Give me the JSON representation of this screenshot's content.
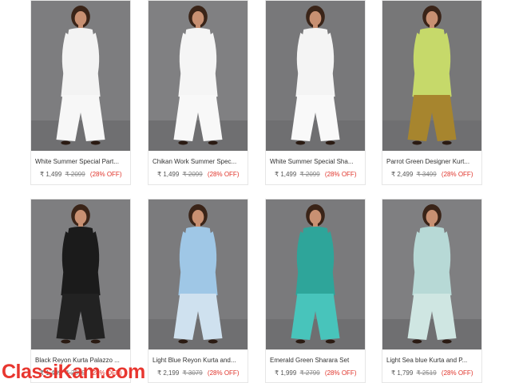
{
  "products": [
    {
      "name": "White Summer Special Part...",
      "price": "₹ 1,499",
      "mrp": "₹ 2099",
      "discount": "(28% OFF)",
      "bg": "#7d7d7f",
      "dress": "#f3f3f3",
      "bottom": "#f7f7f7"
    },
    {
      "name": "Chikan Work Summer Spec...",
      "price": "₹ 1,499",
      "mrp": "₹ 2099",
      "discount": "(28% OFF)",
      "bg": "#808082",
      "dress": "#f5f5f5",
      "bottom": "#f8f8f8"
    },
    {
      "name": "White Summer Special Sha...",
      "price": "₹ 1,499",
      "mrp": "₹ 2099",
      "discount": "(28% OFF)",
      "bg": "#78787a",
      "dress": "#f4f4f4",
      "bottom": "#f9f9f9"
    },
    {
      "name": "Parrot Green Designer Kurt...",
      "price": "₹ 2,499",
      "mrp": "₹ 3499",
      "discount": "(28% OFF)",
      "bg": "#777778",
      "dress": "#c6d96a",
      "bottom": "#a7852e"
    },
    {
      "name": "Black Reyon Kurta Palazzo ...",
      "price": "₹ 1,499",
      "mrp": "₹ 2099",
      "discount": "(28% OFF)",
      "bg": "#7e7e80",
      "dress": "#1b1b1b",
      "bottom": "#222222"
    },
    {
      "name": "Light Blue Reyon Kurta and...",
      "price": "₹ 2,199",
      "mrp": "₹ 3079",
      "discount": "(28% OFF)",
      "bg": "#7b7b7d",
      "dress": "#9fc7e6",
      "bottom": "#cfe1ef"
    },
    {
      "name": "Emerald Green Sharara Set",
      "price": "₹ 1,999",
      "mrp": "₹ 2799",
      "discount": "(28% OFF)",
      "bg": "#7a7a7c",
      "dress": "#2ea59a",
      "bottom": "#48c4bb"
    },
    {
      "name": "Light Sea blue Kurta and P...",
      "price": "₹ 1,799",
      "mrp": "₹ 2519",
      "discount": "(28% OFF)",
      "bg": "#7f7f81",
      "dress": "#b7d9d6",
      "bottom": "#cfe6e2"
    }
  ],
  "watermark": {
    "part1": "Classi",
    "part2": "Kam",
    "part3": ".com"
  }
}
